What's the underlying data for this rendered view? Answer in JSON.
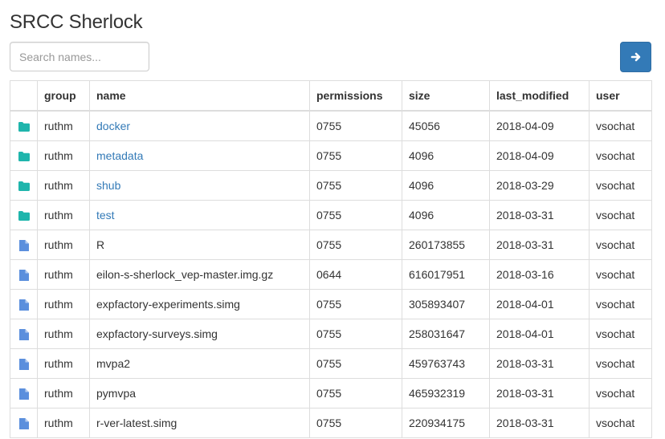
{
  "page": {
    "title": "SRCC Sherlock"
  },
  "search": {
    "placeholder": "Search names..."
  },
  "table": {
    "columns": [
      "",
      "group",
      "name",
      "permissions",
      "size",
      "last_modified",
      "user"
    ],
    "rows": [
      {
        "type": "folder",
        "icon": "folder-icon",
        "group": "ruthm",
        "name": "docker",
        "permissions": "0755",
        "size": "45056",
        "last_modified": "2018-04-09",
        "user": "vsochat"
      },
      {
        "type": "folder",
        "icon": "folder-icon",
        "group": "ruthm",
        "name": "metadata",
        "permissions": "0755",
        "size": "4096",
        "last_modified": "2018-04-09",
        "user": "vsochat"
      },
      {
        "type": "folder",
        "icon": "folder-icon",
        "group": "ruthm",
        "name": "shub",
        "permissions": "0755",
        "size": "4096",
        "last_modified": "2018-03-29",
        "user": "vsochat"
      },
      {
        "type": "folder",
        "icon": "folder-icon",
        "group": "ruthm",
        "name": "test",
        "permissions": "0755",
        "size": "4096",
        "last_modified": "2018-03-31",
        "user": "vsochat"
      },
      {
        "type": "file",
        "icon": "file-icon",
        "group": "ruthm",
        "name": "R",
        "permissions": "0755",
        "size": "260173855",
        "last_modified": "2018-03-31",
        "user": "vsochat"
      },
      {
        "type": "file",
        "icon": "file-icon",
        "group": "ruthm",
        "name": "eilon-s-sherlock_vep-master.img.gz",
        "permissions": "0644",
        "size": "616017951",
        "last_modified": "2018-03-16",
        "user": "vsochat"
      },
      {
        "type": "file",
        "icon": "file-icon",
        "group": "ruthm",
        "name": "expfactory-experiments.simg",
        "permissions": "0755",
        "size": "305893407",
        "last_modified": "2018-04-01",
        "user": "vsochat"
      },
      {
        "type": "file",
        "icon": "file-icon",
        "group": "ruthm",
        "name": "expfactory-surveys.simg",
        "permissions": "0755",
        "size": "258031647",
        "last_modified": "2018-04-01",
        "user": "vsochat"
      },
      {
        "type": "file",
        "icon": "file-icon",
        "group": "ruthm",
        "name": "mvpa2",
        "permissions": "0755",
        "size": "459763743",
        "last_modified": "2018-03-31",
        "user": "vsochat"
      },
      {
        "type": "file",
        "icon": "file-icon",
        "group": "ruthm",
        "name": "pymvpa",
        "permissions": "0755",
        "size": "465932319",
        "last_modified": "2018-03-31",
        "user": "vsochat"
      },
      {
        "type": "file",
        "icon": "file-icon",
        "group": "ruthm",
        "name": "r-ver-latest.simg",
        "permissions": "0755",
        "size": "220934175",
        "last_modified": "2018-03-31",
        "user": "vsochat"
      }
    ]
  },
  "submit_button": {
    "icon": "arrow-right-icon"
  },
  "colors": {
    "folder_icon": "#1fb5ac",
    "file_icon": "#5b8fdd",
    "link": "#337ab7",
    "button": "#337ab7"
  }
}
